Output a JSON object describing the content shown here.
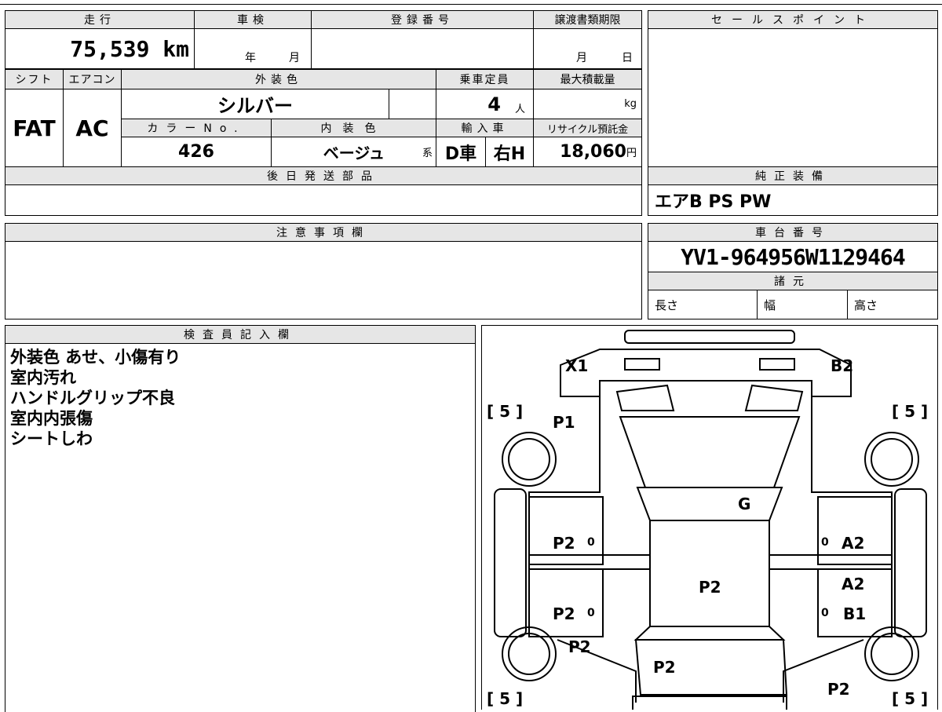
{
  "sheet": {
    "mileage": {
      "label": "走行",
      "value": "75,539 km"
    },
    "shaken": {
      "label": "車検",
      "year_unit": "年",
      "month_unit": "月"
    },
    "registration": {
      "label": "登録番号",
      "value": ""
    },
    "transfer_deadline": {
      "label": "譲渡書類期限",
      "month_unit": "月",
      "day_unit": "日"
    },
    "shift": {
      "label": "シフト",
      "value": "FAT"
    },
    "aircon": {
      "label": "エアコン",
      "value": "AC"
    },
    "exterior_color": {
      "label": "外装色",
      "value": "シルバー"
    },
    "capacity": {
      "label": "乗車定員",
      "value": "4",
      "unit": "人"
    },
    "max_load": {
      "label": "最大積載量",
      "value": "",
      "unit": "kg"
    },
    "color_no": {
      "label": "カラーNo.",
      "value": "426"
    },
    "interior_color": {
      "label": "内装色",
      "value": "ベージュ",
      "suffix": "系"
    },
    "import": {
      "label": "輸入車",
      "d": "D車",
      "h": "右H"
    },
    "recycle": {
      "label": "リサイクル預託金",
      "value": "18,060",
      "unit": "円"
    },
    "later_parts": {
      "label": "後日発送部品",
      "value": ""
    },
    "sales_point": {
      "label": "セールスポイント",
      "value": ""
    },
    "genuine_equipment": {
      "label": "純正装備",
      "value": "エアB PS PW"
    },
    "notes": {
      "label": "注意事項欄",
      "value": ""
    },
    "chassis_no": {
      "label": "車台番号",
      "value": "YV1-964956W1129464"
    },
    "specs": {
      "label": "諸元",
      "length": "長さ",
      "width": "幅",
      "height": "高さ"
    },
    "inspector": {
      "label": "検査員記入欄",
      "lines": [
        "外装色 あせ、小傷有り",
        "室内汚れ",
        "ハンドルグリップ不良",
        "室内内張傷",
        "シートしわ"
      ]
    }
  },
  "diagram": {
    "tire_marks": [
      "[ 5 ]",
      "[ 5 ]",
      "[ 5 ]",
      "[ 5 ]"
    ],
    "codes": {
      "x1": "X1",
      "b2": "B2",
      "p1": "P1",
      "g": "G",
      "p2_left_front": "P2",
      "p2_left_rear": "P2",
      "a2_right_front": "A2",
      "p2_center": "P2",
      "a2_right": "A2",
      "b1_right": "B1",
      "p2_left_lower": "P2",
      "p2_rear": "P2",
      "p2_right_rear": "P2"
    },
    "zero_marks": [
      "0",
      "0",
      "0",
      "0"
    ]
  }
}
